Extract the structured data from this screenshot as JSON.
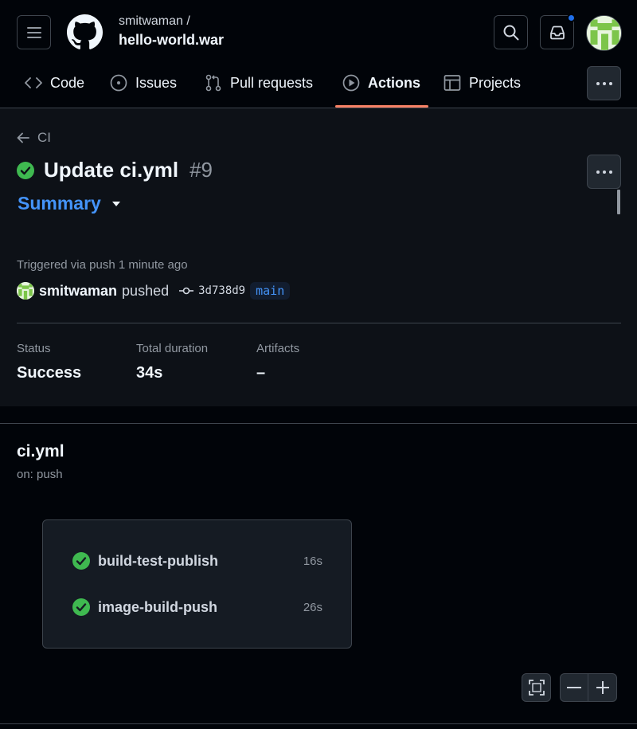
{
  "repo": {
    "owner": "smitwaman /",
    "name": "hello-world.war"
  },
  "tabs": [
    {
      "label": "Code",
      "icon": "code-icon"
    },
    {
      "label": "Issues",
      "icon": "issue-icon"
    },
    {
      "label": "Pull requests",
      "icon": "pull-request-icon"
    },
    {
      "label": "Actions",
      "icon": "play-icon",
      "active": true
    },
    {
      "label": "Projects",
      "icon": "table-icon"
    }
  ],
  "run": {
    "back_label": "CI",
    "title": "Update ci.yml",
    "number": "#9",
    "summary_label": "Summary",
    "triggered": "Triggered via push 1 minute ago",
    "actor": "smitwaman",
    "action": "pushed",
    "commit_sha": "3d738d9",
    "branch": "main"
  },
  "stats": {
    "status_label": "Status",
    "status_value": "Success",
    "duration_label": "Total duration",
    "duration_value": "34s",
    "artifacts_label": "Artifacts",
    "artifacts_value": "–"
  },
  "workflow": {
    "file": "ci.yml",
    "trigger": "on: push",
    "jobs": [
      {
        "name": "build-test-publish",
        "duration": "16s",
        "status": "success"
      },
      {
        "name": "image-build-push",
        "duration": "26s",
        "status": "success"
      }
    ]
  },
  "colors": {
    "success": "#3fb950",
    "link": "#4493f8",
    "active_tab": "#f78166",
    "notification": "#1f6feb"
  }
}
